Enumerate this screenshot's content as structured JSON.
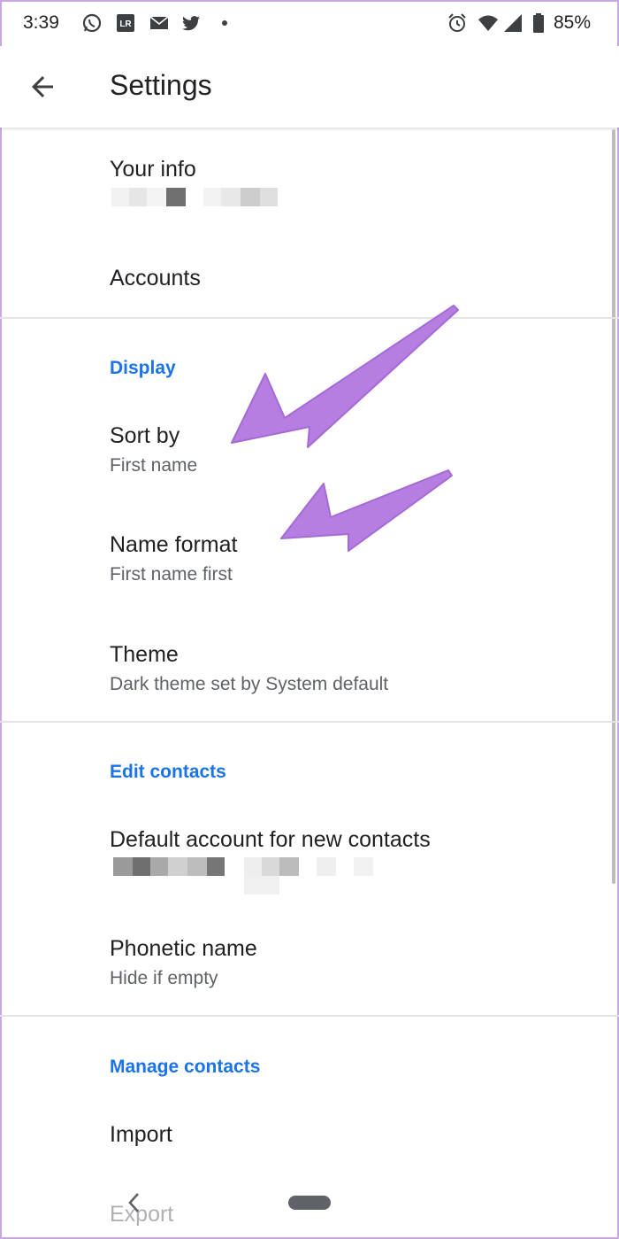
{
  "status_bar": {
    "time": "3:39",
    "battery_percent": "85%",
    "icons": [
      "whatsapp-icon",
      "app-lr-icon",
      "mail-icon",
      "twitter-icon",
      "dot-icon",
      "alarm-icon",
      "wifi-icon",
      "signal-icon",
      "battery-icon"
    ]
  },
  "app_bar": {
    "title": "Settings",
    "back_icon": "arrow-left-icon"
  },
  "items": {
    "your_info": {
      "title": "Your info"
    },
    "accounts": {
      "title": "Accounts"
    },
    "sort_by": {
      "title": "Sort by",
      "subtitle": "First name"
    },
    "name_format": {
      "title": "Name format",
      "subtitle": "First name first"
    },
    "theme": {
      "title": "Theme",
      "subtitle": "Dark theme set by System default"
    },
    "default_account": {
      "title": "Default account for new contacts"
    },
    "phonetic_name": {
      "title": "Phonetic name",
      "subtitle": "Hide if empty"
    },
    "import": {
      "title": "Import"
    },
    "export": {
      "title": "Export"
    }
  },
  "sections": {
    "display": "Display",
    "edit_contacts": "Edit contacts",
    "manage_contacts": "Manage contacts"
  },
  "colors": {
    "accent": "#1a73e8",
    "annotation_arrow": "#b57ee0",
    "frame": "#c9a6e6"
  },
  "nav_bar": {
    "back_icon": "chevron-left-icon",
    "home_icon": "home-pill-icon"
  }
}
